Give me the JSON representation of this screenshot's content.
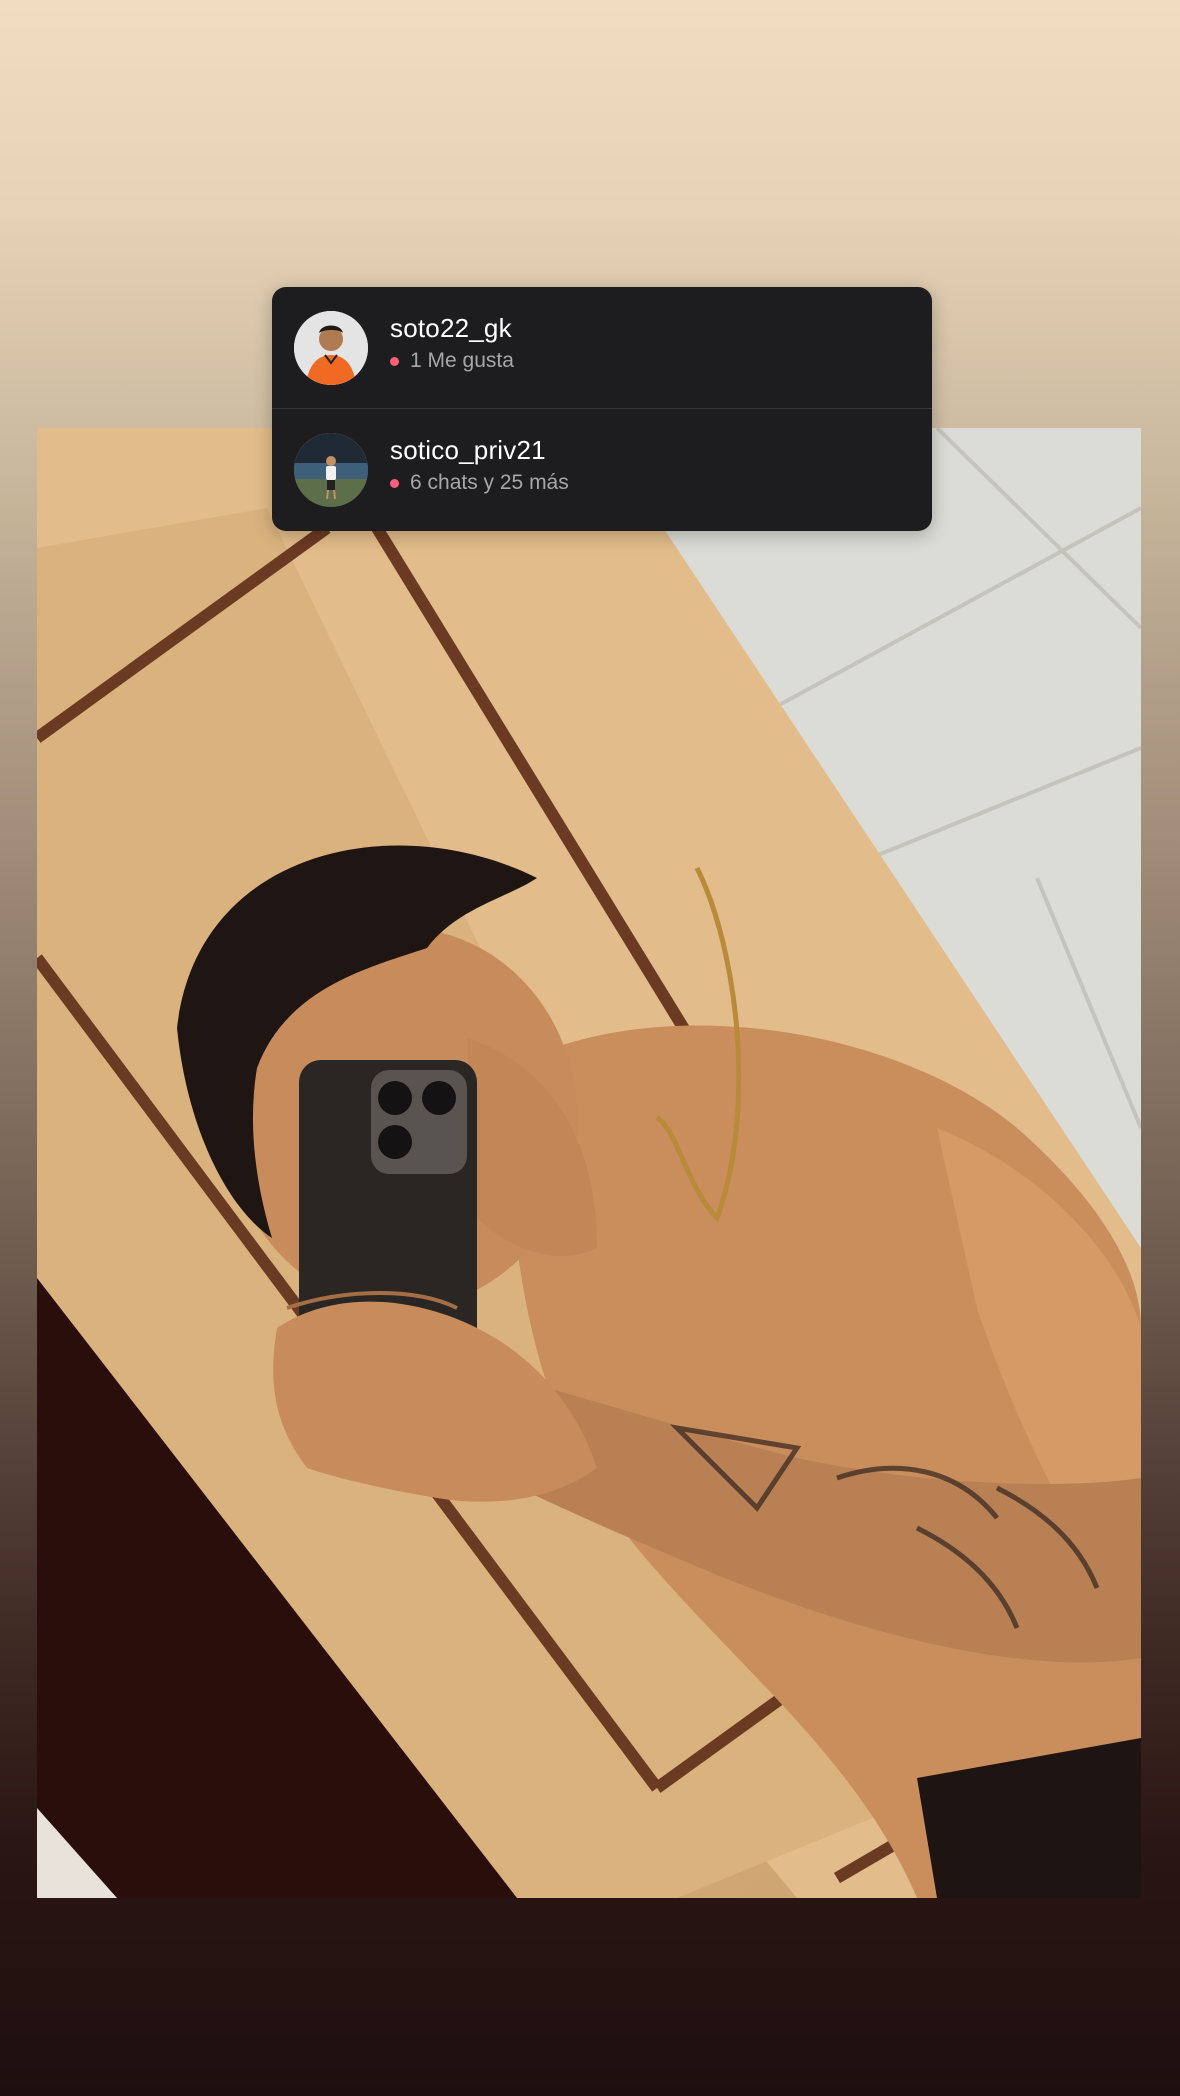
{
  "colors": {
    "card_background": "#1d1d20",
    "username_text": "#ffffff",
    "meta_text": "#a6a6ab",
    "activity_dot": "#ff5d78"
  },
  "story": {
    "photo_icon": "mirror-selfie-photo"
  },
  "activity": [
    {
      "username": "soto22_gk",
      "activity_text": "1 Me gusta",
      "avatar_icon": "profile-avatar-orange-shirt"
    },
    {
      "username": "sotico_priv21",
      "activity_text": "6 chats y 25 más",
      "avatar_icon": "profile-avatar-outdoor"
    }
  ]
}
